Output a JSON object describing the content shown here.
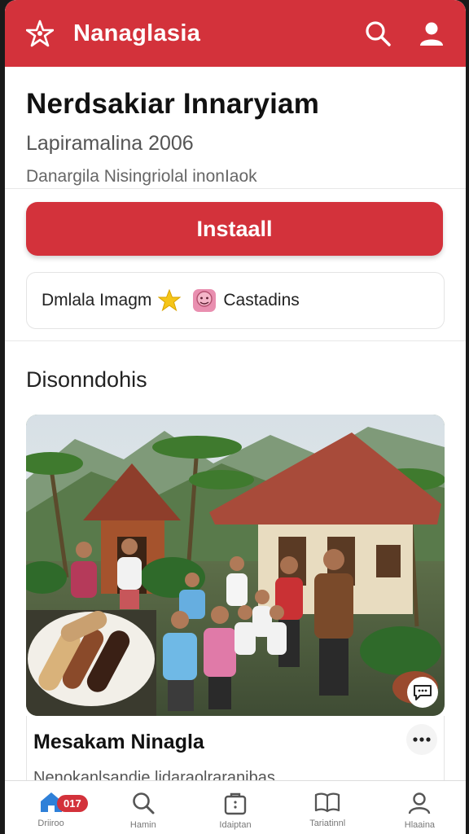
{
  "header": {
    "app_name": "Nanaglasia",
    "search_icon": "search-icon",
    "profile_icon": "profile-icon",
    "brand_color": "#d3323b"
  },
  "app_info": {
    "title": "Nerdsakiar Innaryiam",
    "subtitle": "Lapiramalina 2006",
    "developer": "Danargila Nisingriolal inonIaok"
  },
  "install": {
    "label": "Instaall"
  },
  "rating": {
    "label": "Dmlala Imagm",
    "star_icon": "star-icon",
    "face_icon": "face-icon",
    "category": "Castadins"
  },
  "section": {
    "title": "Disonndohis"
  },
  "featured": {
    "title": "Mesakam Ninagla",
    "description": "Nenokanlsandie lidaraolraranibas."
  },
  "bottom_nav": {
    "badge": "017",
    "items": [
      {
        "label": "Driiroo",
        "icon": "home-icon"
      },
      {
        "label": "Hamin",
        "icon": "search-icon"
      },
      {
        "label": "Idaiptan",
        "icon": "bag-icon"
      },
      {
        "label": "Tariatinnl",
        "icon": "book-icon"
      },
      {
        "label": "Hlaaina",
        "icon": "profile-icon"
      }
    ]
  }
}
